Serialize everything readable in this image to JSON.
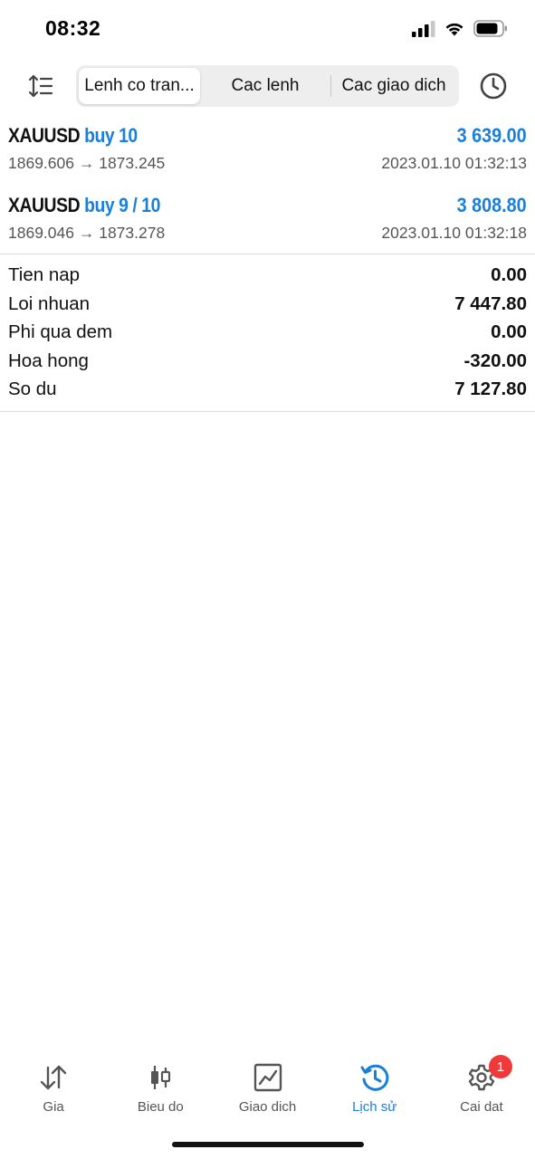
{
  "status_bar": {
    "time": "08:32"
  },
  "toolbar": {
    "tabs": [
      {
        "label": "Lenh co tran...",
        "active": true
      },
      {
        "label": "Cac lenh",
        "active": false
      },
      {
        "label": "Cac giao dich",
        "active": false
      }
    ]
  },
  "trades": [
    {
      "symbol": "XAUUSD",
      "side": "buy 10",
      "profit": "3 639.00",
      "prices": "1869.606 → 1873.245",
      "time": "2023.01.10 01:32:13"
    },
    {
      "symbol": "XAUUSD",
      "side": "buy 9 / 10",
      "profit": "3 808.80",
      "prices": "1869.046 → 1873.278",
      "time": "2023.01.10 01:32:18"
    }
  ],
  "summary": [
    {
      "label": "Tien nap",
      "value": "0.00"
    },
    {
      "label": "Loi nhuan",
      "value": "7 447.80"
    },
    {
      "label": "Phi qua dem",
      "value": "0.00"
    },
    {
      "label": "Hoa hong",
      "value": "-320.00"
    },
    {
      "label": "So du",
      "value": "7 127.80"
    }
  ],
  "tabbar": {
    "items": [
      {
        "label": "Gia",
        "icon": "price-arrows-icon",
        "active": false
      },
      {
        "label": "Bieu do",
        "icon": "candlestick-icon",
        "active": false
      },
      {
        "label": "Giao dich",
        "icon": "trade-chart-icon",
        "active": false
      },
      {
        "label": "Lịch sử",
        "icon": "history-icon",
        "active": true
      },
      {
        "label": "Cai dat",
        "icon": "gear-icon",
        "active": false,
        "badge": "1"
      }
    ]
  },
  "colors": {
    "accent": "#1a7fd9",
    "badge": "#f03a3a"
  }
}
